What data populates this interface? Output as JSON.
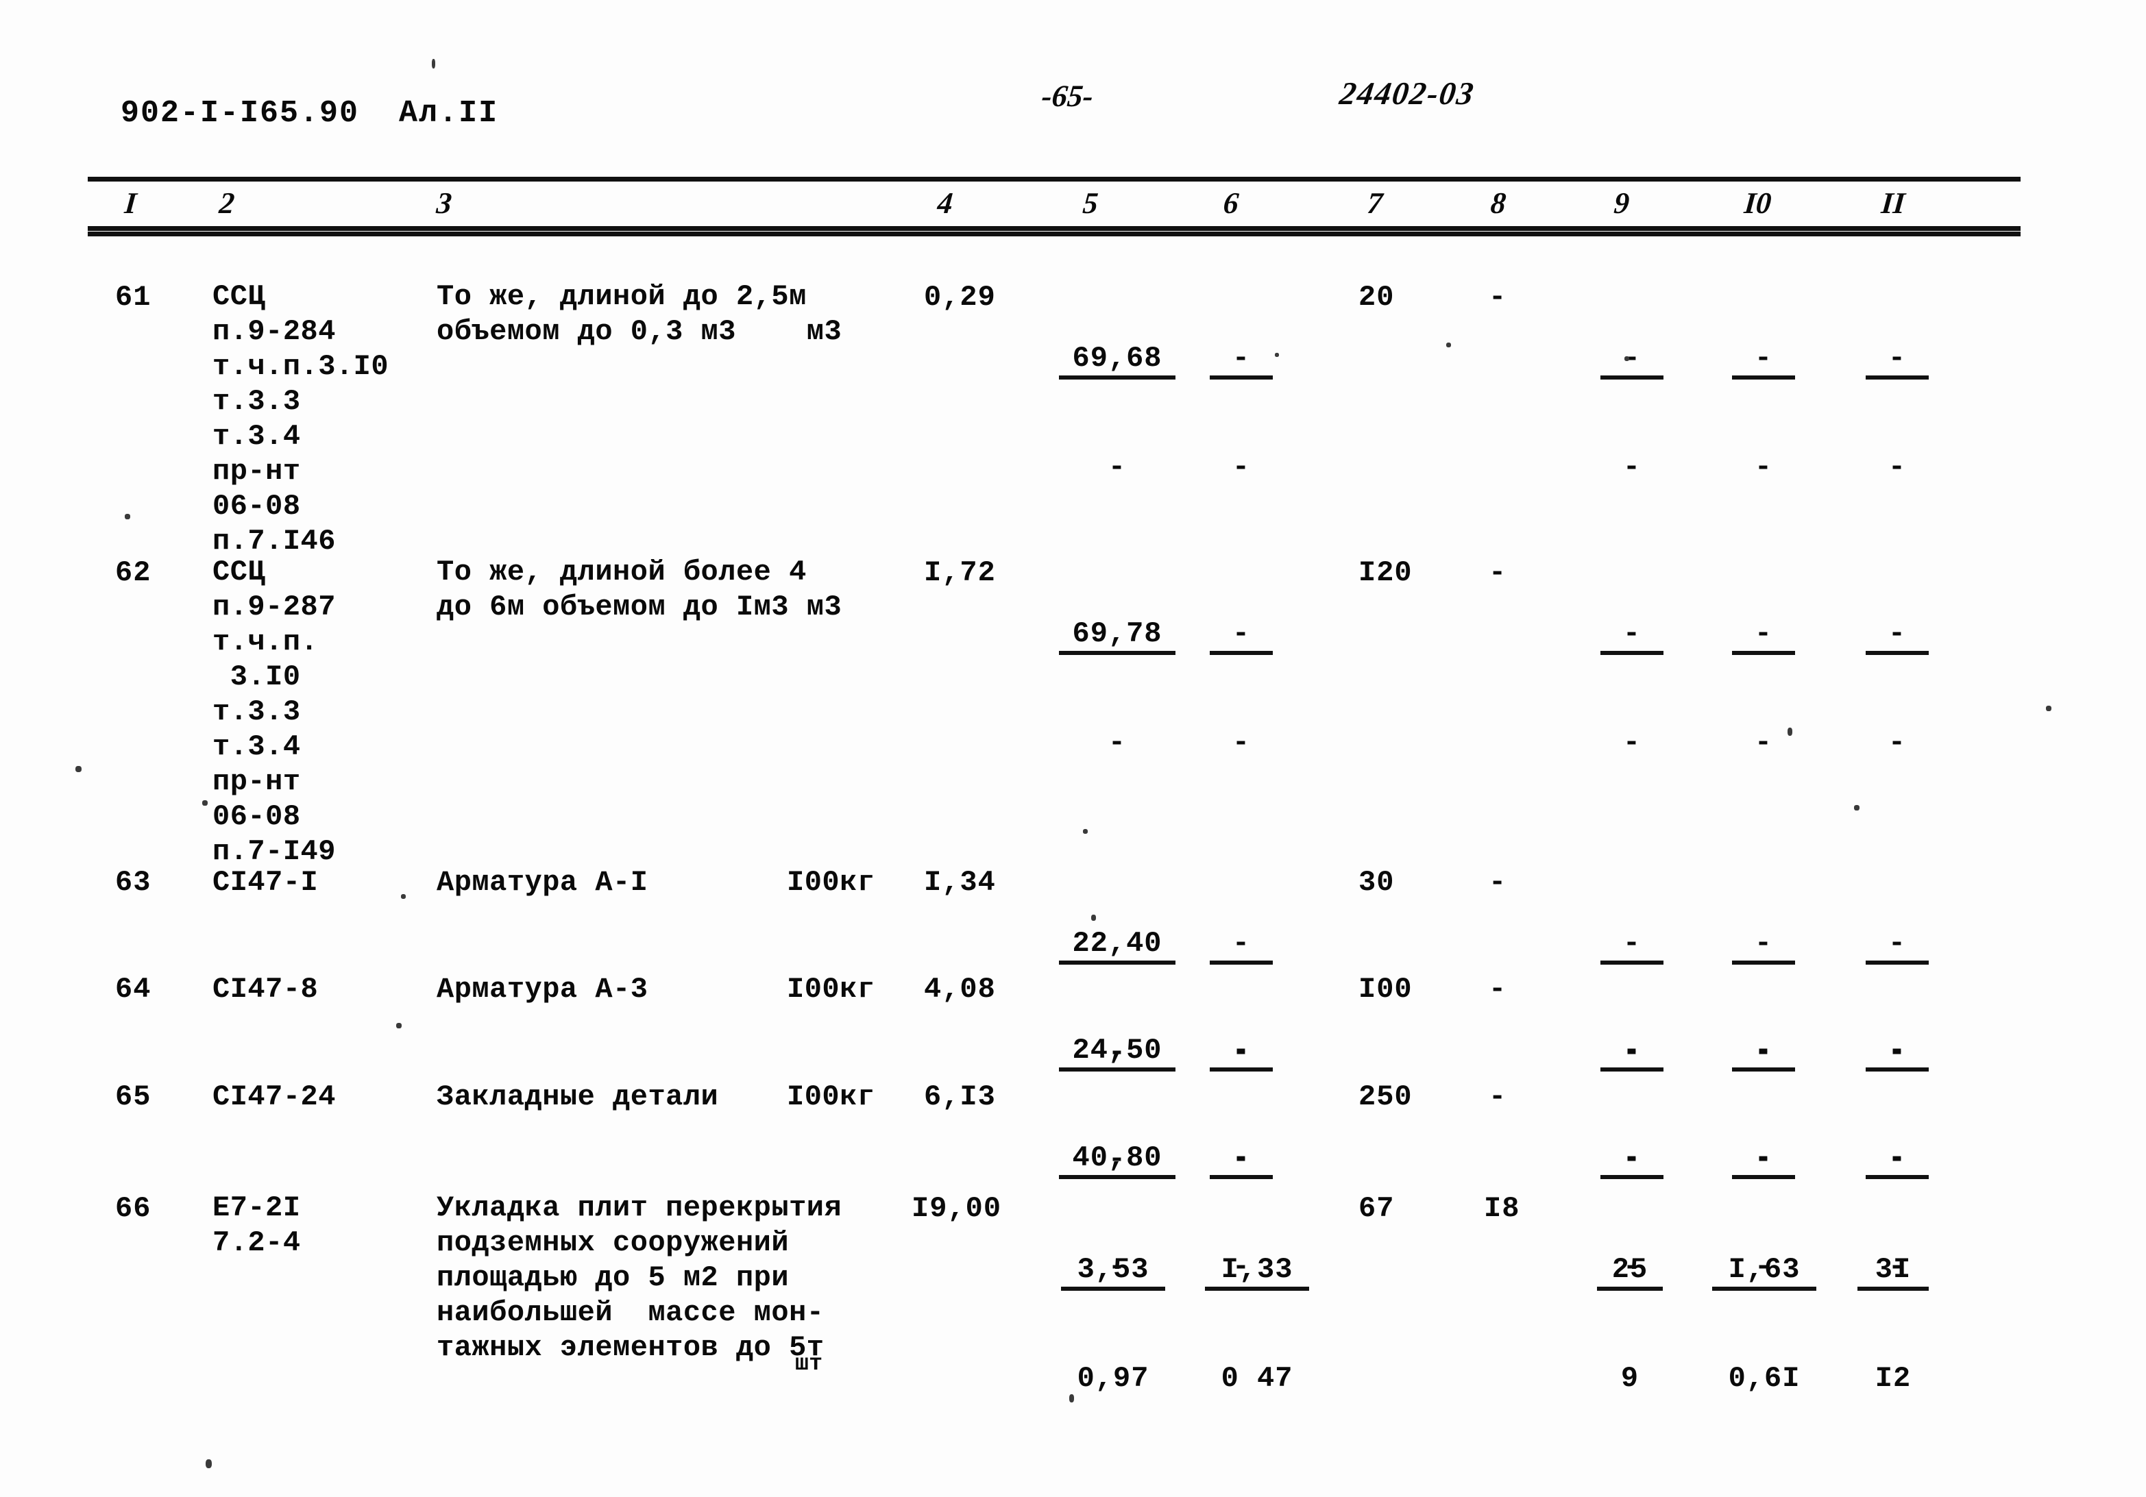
{
  "header": {
    "doc_code": "902-I-I65.90  Ал.II",
    "page_number": "-65-",
    "doc_ref": "24402-03"
  },
  "table": {
    "column_headers": [
      "I",
      "2",
      "3",
      "4",
      "5",
      "6",
      "7",
      "8",
      "9",
      "I0",
      "II"
    ],
    "rows": [
      {
        "num": "61",
        "code": "ССЦ\nп.9-284\nт.ч.п.3.I0\nт.3.3\nт.3.4\nпр-нт\n06-08\nп.7.I46",
        "description": "То же, длиной до 2,5м\nобъемом до 0,3 м3    м3",
        "col4": "0,29",
        "col5_top": "69,68",
        "col5_bot": "-",
        "col6_top": "-",
        "col6_bot": "-",
        "col7": "20",
        "col8": "-",
        "col9_top": "-",
        "col9_bot": "-",
        "col10_top": "-",
        "col10_bot": "-",
        "col11_top": "-",
        "col11_bot": "-"
      },
      {
        "num": "62",
        "code": "ССЦ\nп.9-287\nт.ч.п.\n 3.I0\nт.3.3\nт.3.4\nпр-нт\n06-08\nп.7-I49",
        "description": "То же, длиной более 4\nдо 6м объемом до Iм3 м3",
        "col4": "I,72",
        "col5_top": "69,78",
        "col5_bot": "-",
        "col6_top": "-",
        "col6_bot": "-",
        "col7": "I20",
        "col8": "-",
        "col9_top": "-",
        "col9_bot": "-",
        "col10_top": "-",
        "col10_bot": "-",
        "col11_top": "-",
        "col11_bot": "-"
      },
      {
        "num": "63",
        "code": "CI47-I",
        "description": "Арматура А-I",
        "unit": "I00кг",
        "col4": "I,34",
        "col5_top": "22,40",
        "col5_bot": "-",
        "col6_top": "-",
        "col6_bot": "-",
        "col7": "30",
        "col8": "-",
        "col9_top": "-",
        "col9_bot": "-",
        "col10_top": "-",
        "col10_bot": "-",
        "col11_top": "-",
        "col11_bot": "-"
      },
      {
        "num": "64",
        "code": "CI47-8",
        "description": "Арматура А-3",
        "unit": "I00кг",
        "col4": "4,08",
        "col5_top": "24,50",
        "col5_bot": "-",
        "col6_top": "-",
        "col6_bot": "-",
        "col7": "I00",
        "col8": "-",
        "col9_top": "-",
        "col9_bot": "-",
        "col10_top": "-",
        "col10_bot": "-",
        "col11_top": "-",
        "col11_bot": "-"
      },
      {
        "num": "65",
        "code": "CI47-24",
        "description": "Закладные детали",
        "unit": "I00кг",
        "col4": "6,I3",
        "col5_top": "40,80",
        "col5_bot": "-",
        "col6_top": "-",
        "col6_bot": "-",
        "col7": "250",
        "col8": "-",
        "col9_top": "-",
        "col9_bot": "-",
        "col10_top": "-",
        "col10_bot": "-",
        "col11_top": "-",
        "col11_bot": "-"
      },
      {
        "num": "66",
        "code": "E7-2I\n7.2-4",
        "description": "Укладка плит перекрытия\nподземных сооружений\nплощадью до 5 м2 при\nнаибольшей  массе мон-\nтажных элементов до 5т",
        "unit": "шт",
        "col4": "I9,00",
        "col5_top": "3,53",
        "col5_bot": "0,97",
        "col6_top": "I,33",
        "col6_bot": "0 47",
        "col7": "67",
        "col8": "I8",
        "col9_top": "25",
        "col9_bot": "9",
        "col10_top": "I,63",
        "col10_bot": "0,6I",
        "col11_top": "3I",
        "col11_bot": "I2"
      }
    ]
  }
}
